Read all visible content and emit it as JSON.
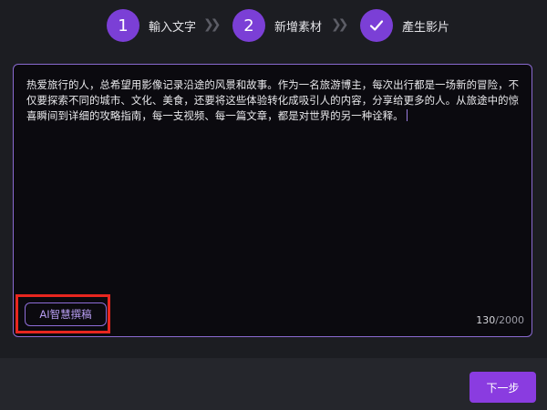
{
  "stepper": {
    "steps": [
      {
        "number": "1",
        "label": "輸入文字",
        "state": "active"
      },
      {
        "number": "2",
        "label": "新增素材",
        "state": "active"
      },
      {
        "number": "",
        "icon": "checkmark-icon",
        "label": "產生影片",
        "state": "active"
      }
    ],
    "separator": "»"
  },
  "editor": {
    "text": "热爱旅行的人，总希望用影像记录沿途的风景和故事。作为一名旅游博主，每次出行都是一场新的冒险，不仅要探索不同的城市、文化、美食，还要将这些体验转化成吸引人的内容，分享给更多的人。从旅途中的惊喜瞬间到详细的攻略指南，每一支视频、每一篇文章，都是对世界的另一种诠释。",
    "ai_button_label": "AI智慧撰稿",
    "char_count": "130",
    "char_limit": "/2000"
  },
  "footer": {
    "next_label": "下一步"
  },
  "colors": {
    "accent": "#7b3fd6",
    "editor_border": "#8a6ad1",
    "highlight": "#e8261f",
    "background": "#1c1d22"
  }
}
